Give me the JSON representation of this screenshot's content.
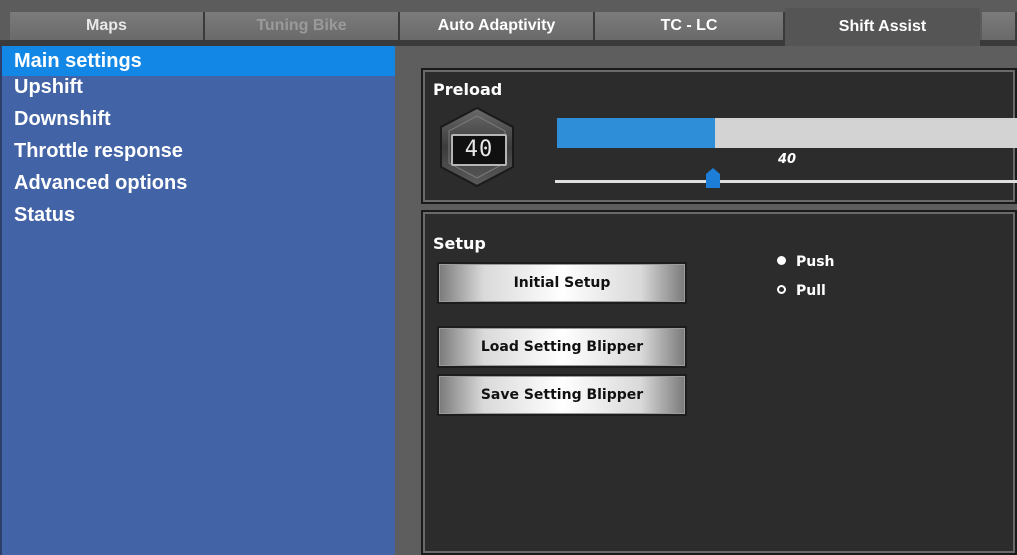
{
  "tabs": [
    {
      "label": "Maps"
    },
    {
      "label": "Tuning Bike"
    },
    {
      "label": "Auto Adaptivity"
    },
    {
      "label": "TC - LC"
    },
    {
      "label": "Shift Assist"
    },
    {
      "label": ""
    }
  ],
  "sidebar": {
    "items": [
      {
        "label": "Main settings"
      },
      {
        "label": "Upshift"
      },
      {
        "label": "Downshift"
      },
      {
        "label": "Throttle response"
      },
      {
        "label": "Advanced options"
      },
      {
        "label": "Status"
      }
    ]
  },
  "preload": {
    "title": "Preload",
    "display": "40",
    "value_label": "40",
    "level_fraction": 0.33,
    "slider_fraction": 0.33
  },
  "setup": {
    "title": "Setup",
    "initial_setup": "Initial Setup",
    "load_blipper": "Load Setting Blipper",
    "save_blipper": "Save Setting Blipper",
    "mode": {
      "push": "Push",
      "pull": "Pull",
      "selected": "Push"
    }
  },
  "colors": {
    "sidebar_bg": "#4263a5",
    "sidebar_selected": "#1387e6",
    "bar_fill": "#2f8ed8",
    "panel_bg": "#2c2c2c"
  }
}
